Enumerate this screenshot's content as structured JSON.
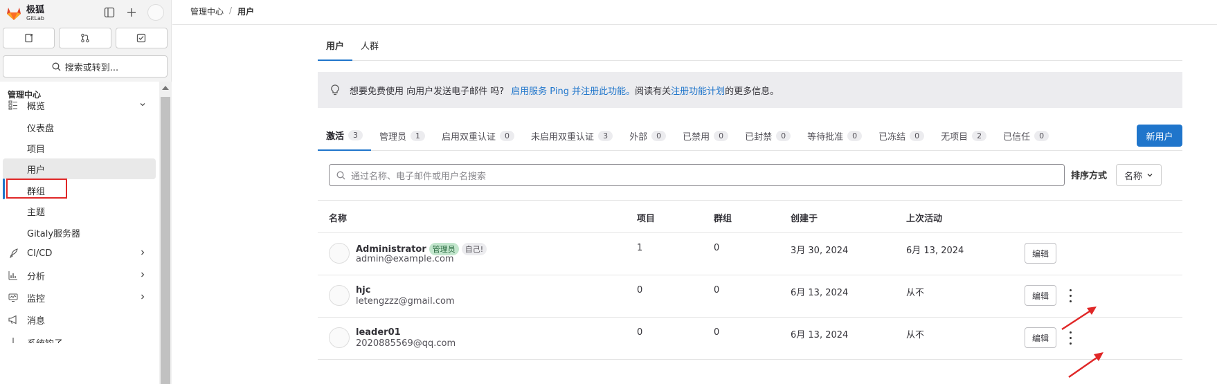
{
  "brand": {
    "name": "极狐",
    "sub": "GitLab"
  },
  "sidebar": {
    "search_label": "搜索或转到...",
    "heading": "管理中心",
    "items": [
      {
        "label": "概览",
        "icon": "overview-icon"
      },
      {
        "label": "仪表盘"
      },
      {
        "label": "项目"
      },
      {
        "label": "用户"
      },
      {
        "label": "群组"
      },
      {
        "label": "主题"
      },
      {
        "label": "Gitaly服务器"
      },
      {
        "label": "CI/CD",
        "icon": "rocket-icon"
      },
      {
        "label": "分析",
        "icon": "chart-icon"
      },
      {
        "label": "监控",
        "icon": "monitor-icon"
      },
      {
        "label": "消息",
        "icon": "bullhorn-icon"
      },
      {
        "label": "系统钩子",
        "icon": "hook-icon"
      }
    ]
  },
  "breadcrumb": {
    "root": "管理中心",
    "sep": "/",
    "current": "用户"
  },
  "tabs": [
    {
      "label": "用户"
    },
    {
      "label": "人群"
    }
  ],
  "banner": {
    "text1": "想要免费使用 向用户发送电子邮件 吗?",
    "link1": "启用服务 Ping 并注册此功能。",
    "text2": " 阅读有关",
    "link2": "注册功能计划",
    "text3": "的更多信息。"
  },
  "filters": [
    {
      "label": "激活",
      "count": "3"
    },
    {
      "label": "管理员",
      "count": "1"
    },
    {
      "label": "启用双重认证",
      "count": "0"
    },
    {
      "label": "未启用双重认证",
      "count": "3"
    },
    {
      "label": "外部",
      "count": "0"
    },
    {
      "label": "已禁用",
      "count": "0"
    },
    {
      "label": "已封禁",
      "count": "0"
    },
    {
      "label": "等待批准",
      "count": "0"
    },
    {
      "label": "已冻结",
      "count": "0"
    },
    {
      "label": "无项目",
      "count": "2"
    },
    {
      "label": "已信任",
      "count": "0"
    }
  ],
  "new_user": "新用户",
  "search": {
    "placeholder": "通过名称、电子邮件或用户名搜索"
  },
  "sort": {
    "label": "排序方式",
    "value": "名称"
  },
  "table": {
    "headers": [
      "名称",
      "项目",
      "群组",
      "创建于",
      "上次活动"
    ],
    "edit_label": "编辑",
    "rows": [
      {
        "name": "Administrator",
        "badge_admin": "管理员",
        "badge_self": "自己!",
        "email": "admin@example.com",
        "projects": "1",
        "groups": "0",
        "created": "3月 30, 2024",
        "last": "6月 13, 2024"
      },
      {
        "name": "hjc",
        "email": "letengzzz@gmail.com",
        "projects": "0",
        "groups": "0",
        "created": "6月 13, 2024",
        "last": "从不"
      },
      {
        "name": "leader01",
        "email": "2020885569@qq.com",
        "projects": "0",
        "groups": "0",
        "created": "6月 13, 2024",
        "last": "从不"
      }
    ]
  },
  "colors": {
    "accent": "#1f75cb",
    "highlight": "#e02727"
  }
}
